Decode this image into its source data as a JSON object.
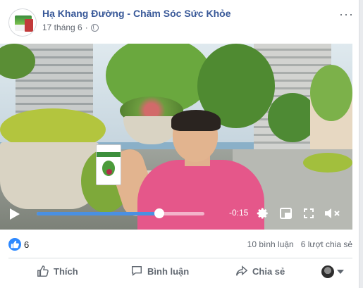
{
  "post": {
    "page_name": "Hạ Khang Đường - Chăm Sóc Sức Khỏe",
    "date": "17 tháng 6",
    "separator": "·",
    "more": "···"
  },
  "video": {
    "time_remaining": "-0:15",
    "progress_fraction": 0.73,
    "accent_color": "#4a90e2"
  },
  "stats": {
    "likes": "6",
    "comments": "10 bình luận",
    "shares": "6 lượt chia sẻ"
  },
  "actions": {
    "like": "Thích",
    "comment": "Bình luận",
    "share": "Chia sẻ"
  },
  "icons": [
    "globe-icon",
    "more-icon",
    "play-icon",
    "settings-icon",
    "pip-icon",
    "fullscreen-icon",
    "mute-icon",
    "like-reaction-icon",
    "like-icon",
    "comment-icon",
    "share-icon"
  ]
}
